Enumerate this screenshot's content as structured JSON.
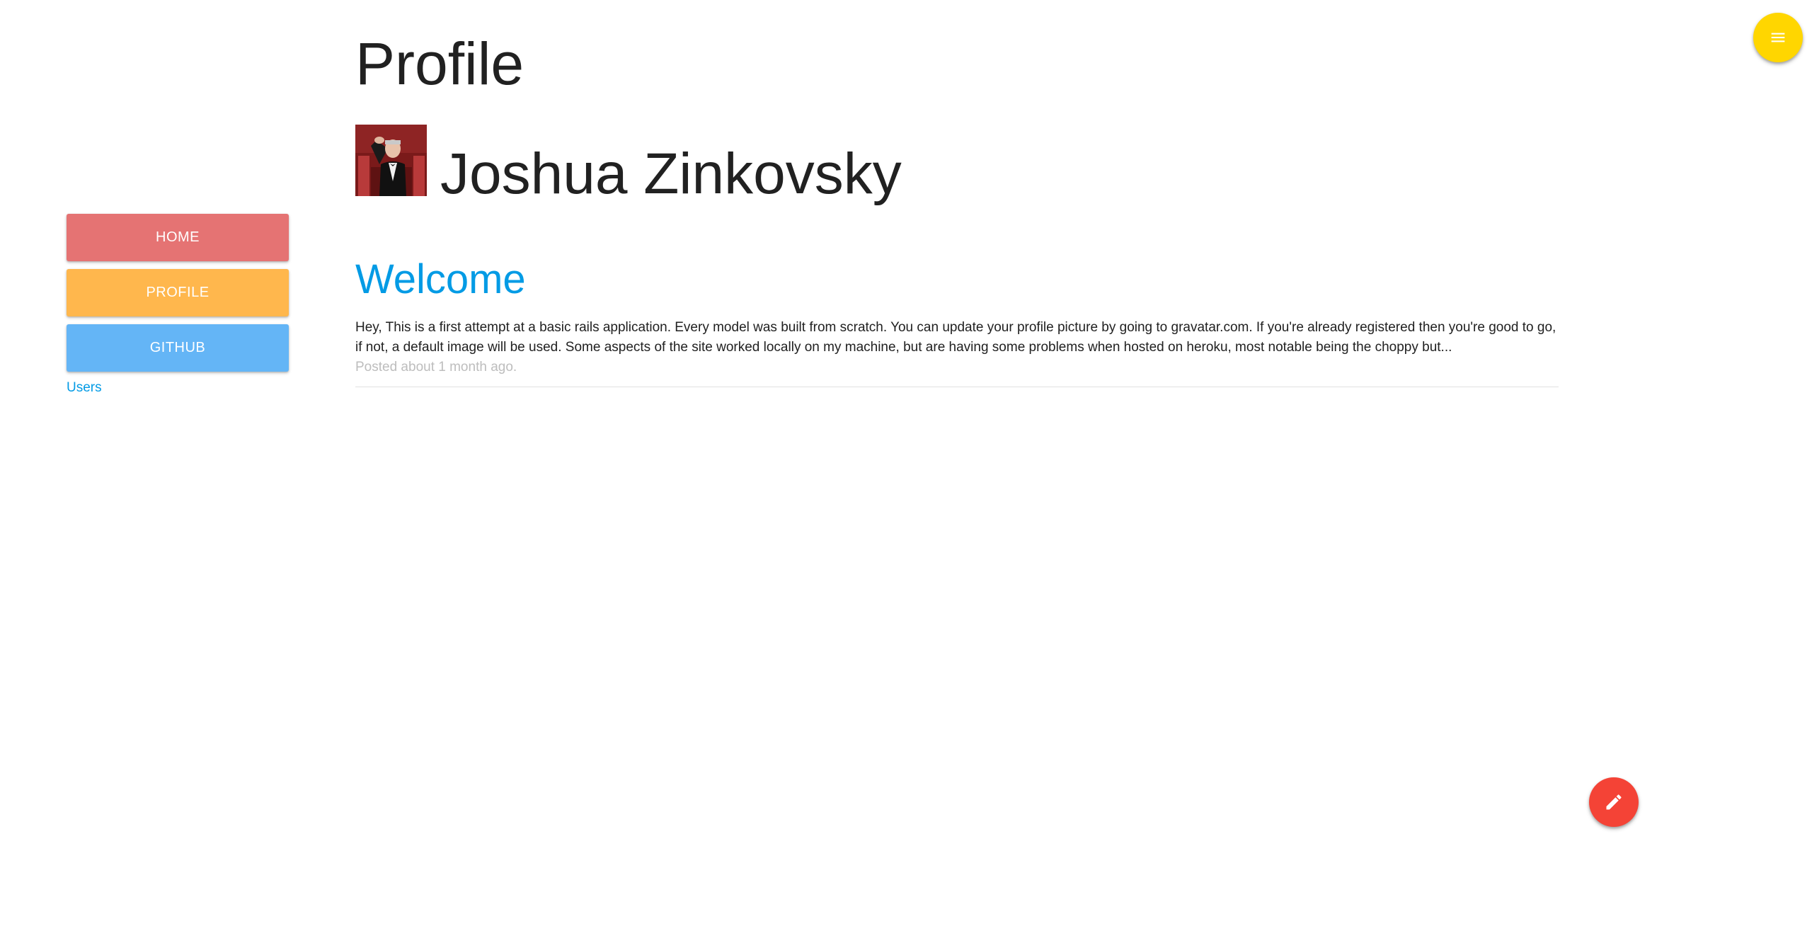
{
  "sidebar": {
    "buttons": [
      {
        "label": "HOME",
        "color": "#e57373"
      },
      {
        "label": "PROFILE",
        "color": "#ffb74d"
      },
      {
        "label": "GITHUB",
        "color": "#64b5f6"
      }
    ],
    "users_link": "Users"
  },
  "main": {
    "page_title": "Profile",
    "user_name": "Joshua Zinkovsky",
    "post": {
      "title": "Welcome",
      "body": "Hey, This is a first attempt at a basic rails application. Every model was built from scratch. You can update your profile picture by going to gravatar.com. If you're already registered then you're good to go, if not, a default image will be used. Some aspects of the site worked locally on my machine, but are having some problems when hosted on heroku, most notable being the choppy but...",
      "meta": "Posted about 1 month ago."
    }
  },
  "fabs": {
    "menu": {
      "icon": "menu-icon",
      "color": "#ffd600"
    },
    "edit": {
      "icon": "pencil-icon",
      "color": "#f44336"
    }
  },
  "colors": {
    "accent_link": "#039be5",
    "muted_text": "#bdbdbd"
  }
}
